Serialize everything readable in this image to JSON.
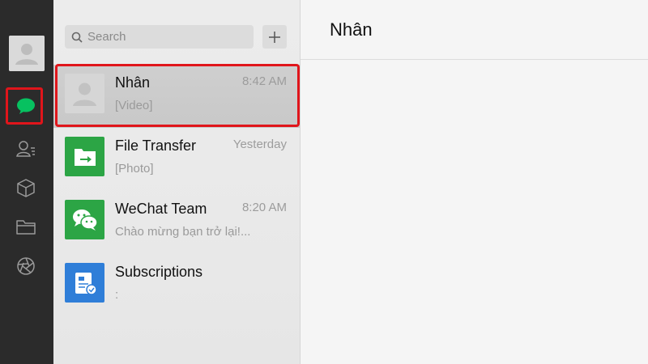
{
  "sidebar": {
    "avatar_icon": "user-silhouette-icon",
    "items": [
      {
        "name": "chats",
        "icon": "chat-bubble-icon",
        "active": true
      },
      {
        "name": "contacts",
        "icon": "contacts-icon"
      },
      {
        "name": "favorites",
        "icon": "cube-icon"
      },
      {
        "name": "files",
        "icon": "folder-icon"
      },
      {
        "name": "moments",
        "icon": "aperture-icon"
      }
    ],
    "active_color": "#07c160"
  },
  "search": {
    "placeholder": "Search"
  },
  "add_button": {
    "label": "+"
  },
  "chats": [
    {
      "name": "Nhân",
      "time": "8:42 AM",
      "preview": "[Video]",
      "avatar": "user-silhouette-icon",
      "selected": true
    },
    {
      "name": "File Transfer",
      "time": "Yesterday",
      "preview": "[Photo]",
      "avatar": "file-transfer-icon",
      "avatar_color": "#2ca545"
    },
    {
      "name": "WeChat Team",
      "time": "8:20 AM",
      "preview": "Chào mừng bạn trở lại!...",
      "avatar": "wechat-icon",
      "avatar_color": "#2ca545"
    },
    {
      "name": "Subscriptions",
      "time": "",
      "preview": ":",
      "avatar": "subscriptions-icon",
      "avatar_color": "#2f7ed8"
    }
  ],
  "conversation": {
    "title": "Nhân"
  },
  "highlight_color": "#e0151b"
}
